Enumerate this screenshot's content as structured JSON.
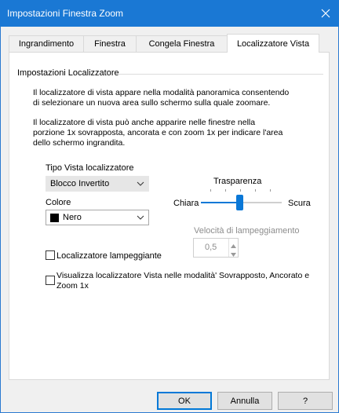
{
  "window": {
    "title": "Impostazioni Finestra Zoom"
  },
  "tabs": [
    {
      "label": "Ingrandimento"
    },
    {
      "label": "Finestra"
    },
    {
      "label": "Congela Finestra"
    },
    {
      "label": "Localizzatore Vista"
    }
  ],
  "active_tab": "Localizzatore Vista",
  "group": {
    "title": "Impostazioni Localizzatore",
    "para1": [
      "Il localizzatore di vista appare nella modalità panoramica consentendo",
      "di selezionare un nuova area sullo schermo sulla quale zoomare."
    ],
    "para2": [
      "Il localizzatore di vista può anche apparire nelle finestre nella",
      "porzione 1x sovrapposta, ancorata e con zoom 1x per indicare l'area",
      "dello schermo ingrandita."
    ]
  },
  "type": {
    "label": "Tipo Vista localizzatore",
    "value": "Blocco Invertito"
  },
  "color": {
    "label": "Colore",
    "value": "Nero",
    "swatch": "#000000"
  },
  "transparency": {
    "label": "Trasparenza",
    "min_label": "Chiara",
    "max_label": "Scura",
    "value_percent": 48
  },
  "blink_speed": {
    "label": "Velocità di lampeggiamento",
    "value": "0,5"
  },
  "checkbox_blink": {
    "label": "Localizzatore lampeggiante",
    "checked": false
  },
  "checkbox_show": {
    "label_line1": "Visualizza localizzatore Vista nelle modalità' Sovrapposto, Ancorato e",
    "label_line2": "Zoom 1x",
    "checked": false
  },
  "buttons": {
    "ok": "OK",
    "cancel": "Annulla",
    "help": "?"
  },
  "colors": {
    "accent": "#0a78d7",
    "titlebar": "#1a78d4"
  },
  "icons": {
    "close": "close-icon",
    "dropdown": "chevron-down-icon",
    "spin_up": "spin-up-icon",
    "spin_down": "spin-down-icon"
  }
}
